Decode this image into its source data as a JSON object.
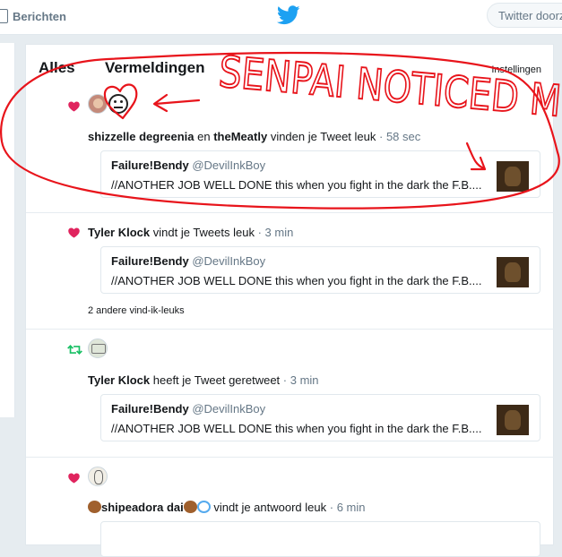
{
  "topbar": {
    "messages_label": "Berichten",
    "search_placeholder": "Twitter doorzoeken"
  },
  "tabs": {
    "all": "Alles",
    "mentions": "Vermeldingen",
    "settings": "Instellingen"
  },
  "notifications": [
    {
      "type": "like",
      "user1": "shizzelle degreenia",
      "connector": "en",
      "user2": "theMeatly",
      "action": "vinden je Tweet leuk",
      "time": "· 58 sec",
      "tweet": {
        "name": "Failure!Bendy",
        "handle": "@DevilInkBoy",
        "text": "//ANOTHER JOB WELL DONE this when you fight in the dark the F.B...."
      }
    },
    {
      "type": "like",
      "user1": "Tyler Klock",
      "action": "vindt je Tweets leuk",
      "time": "· 3 min",
      "tweet": {
        "name": "Failure!Bendy",
        "handle": "@DevilInkBoy",
        "text": "//ANOTHER JOB WELL DONE this when you fight in the dark the F.B...."
      },
      "extra": "2 andere vind-ik-leuks"
    },
    {
      "type": "retweet",
      "user1": "Tyler Klock",
      "action": "heeft je Tweet geretweet",
      "time": "· 3 min",
      "tweet": {
        "name": "Failure!Bendy",
        "handle": "@DevilInkBoy",
        "text": "//ANOTHER JOB WELL DONE this when you fight in the dark the F.B...."
      }
    },
    {
      "type": "like",
      "user1": "shipeadora dai",
      "action": "vindt je antwoord leuk",
      "time": "· 6 min"
    }
  ],
  "annotation": {
    "text": "SENPAI NOTICED ME!!",
    "color": "#e8141b"
  },
  "colors": {
    "like": "#e0245e",
    "retweet": "#17bf63",
    "brand": "#1da1f2"
  }
}
